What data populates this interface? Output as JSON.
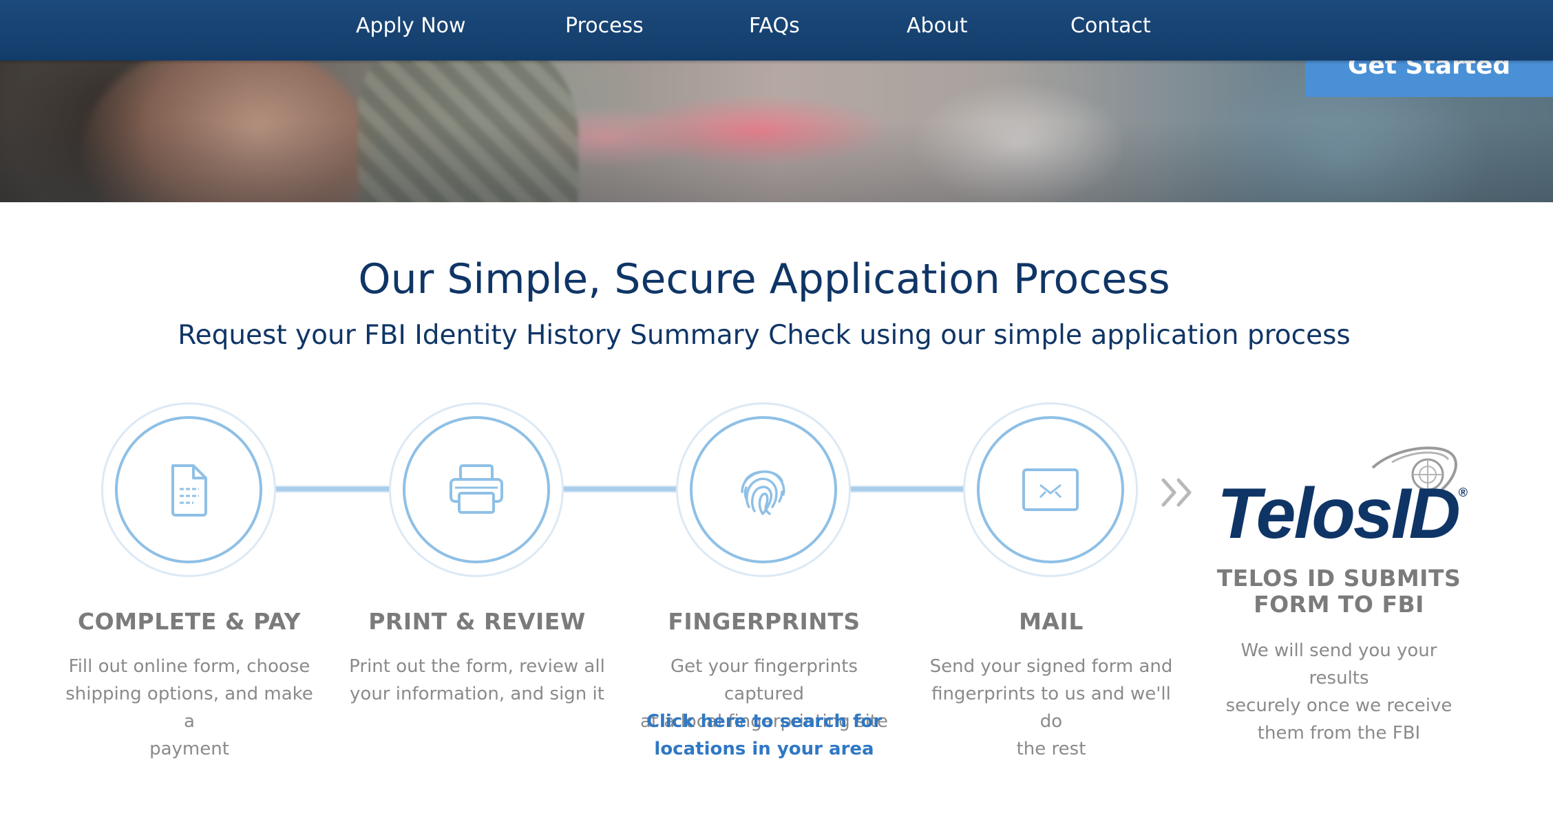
{
  "nav": {
    "items": [
      {
        "label": "Apply Now"
      },
      {
        "label": "Process"
      },
      {
        "label": "FAQs"
      },
      {
        "label": "About"
      },
      {
        "label": "Contact"
      }
    ]
  },
  "hero": {
    "cta_label": "Get Started"
  },
  "process": {
    "title": "Our Simple, Secure Application Process",
    "subtitle": "Request your FBI Identity History Summary Check using our simple application process",
    "steps": [
      {
        "icon": "document-icon",
        "title": "COMPLETE & PAY",
        "description_lines": [
          "Fill out online form, choose",
          "shipping options, and make a",
          "payment"
        ]
      },
      {
        "icon": "printer-icon",
        "title": "PRINT & REVIEW",
        "description_lines": [
          "Print out the form, review all",
          "your information, and sign it"
        ]
      },
      {
        "icon": "fingerprint-icon",
        "title": "FINGERPRINTS",
        "description_lines": [
          "Get your fingerprints captured",
          "at a local fingerprinting site"
        ],
        "link_lines": [
          "Click here to search for",
          "locations in your area"
        ]
      },
      {
        "icon": "envelope-icon",
        "title": "MAIL",
        "description_lines": [
          "Send your signed form and",
          "fingerprints to us and we'll do",
          "the rest"
        ]
      }
    ],
    "final_step": {
      "logo_text": "TelosID",
      "logo_mark": "®",
      "title_lines": [
        "TELOS ID SUBMITS",
        "FORM TO FBI"
      ],
      "description_lines": [
        "We will send you your results",
        "securely once we receive",
        "them from the FBI"
      ]
    }
  },
  "colors": {
    "nav_bg": "#1a4576",
    "heading": "#0f3566",
    "accent": "#8fc0e6",
    "link": "#2f78c4",
    "cta": "#4a90d6",
    "body_text": "#8a8a8a"
  }
}
